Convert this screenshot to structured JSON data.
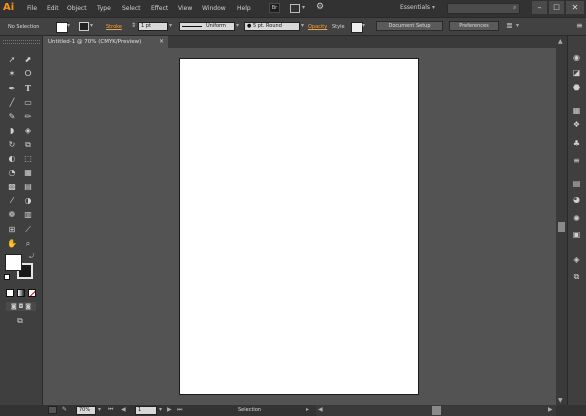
{
  "app": {
    "logo": "Ai"
  },
  "menu": [
    "File",
    "Edit",
    "Object",
    "Type",
    "Select",
    "Effect",
    "View",
    "Window",
    "Help"
  ],
  "workspace": {
    "label": "Essentials"
  },
  "control_bar": {
    "selection_label": "No Selection",
    "stroke_label": "Stroke",
    "stroke_weight": "1 pt",
    "profile": "Uniform",
    "brush": "5 pt. Round",
    "opacity_label": "Opacity",
    "style_label": "Style",
    "document_setup": "Document Setup",
    "preferences": "Preferences"
  },
  "document": {
    "tab_title": "Untitled-1 @ 70% (CMYK/Preview)"
  },
  "status": {
    "zoom": "70%",
    "artboard": "1",
    "tool": "Selection"
  },
  "colors": {
    "accent": "#f7941d",
    "canvas": "#535353",
    "chrome": "#323232"
  },
  "icons": {
    "tools": [
      "selection-arrow",
      "direct-selection",
      "magic-wand",
      "lasso",
      "pen",
      "type",
      "line-segment",
      "rectangle",
      "paintbrush",
      "pencil",
      "blob-brush",
      "eraser",
      "rotate",
      "scale",
      "warp",
      "free-transform",
      "shape-builder",
      "perspective-grid",
      "mesh",
      "gradient",
      "eyedropper",
      "blend",
      "symbol-sprayer",
      "column-graph",
      "artboard",
      "slice",
      "hand",
      "zoom"
    ],
    "dock": [
      "color",
      "color-guide",
      "swatches",
      "brushes",
      "symbols",
      "stroke",
      "gradient",
      "transparency",
      "appearance",
      "graphic-styles",
      "layers",
      "artboards"
    ]
  }
}
